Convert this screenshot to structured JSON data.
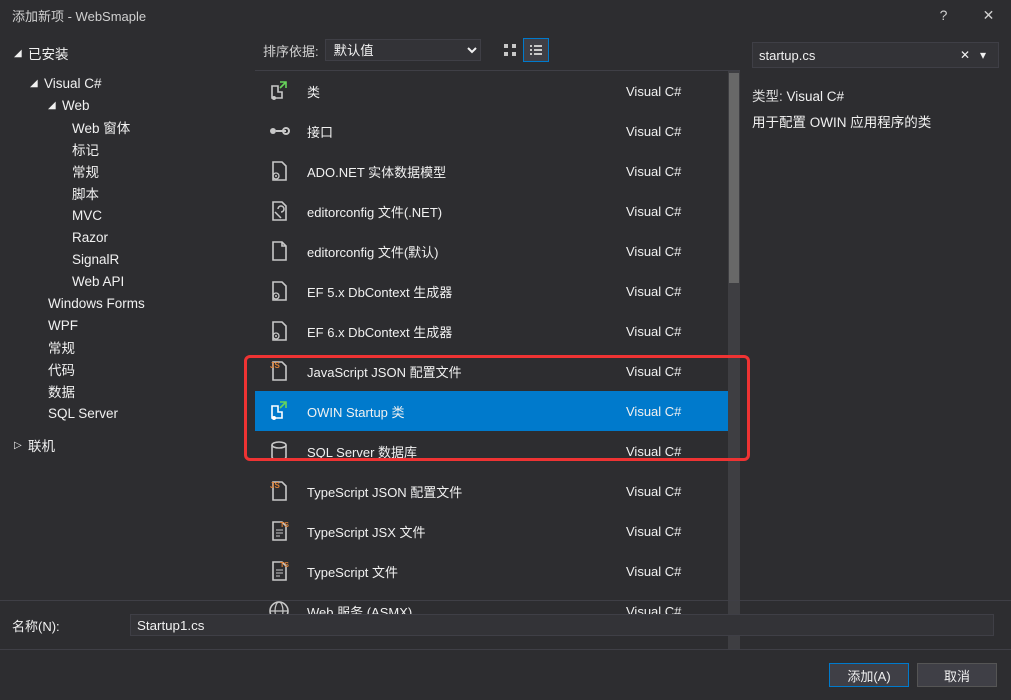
{
  "title": "添加新项 - WebSmaple",
  "tree": {
    "installed": "已安装",
    "csharp": "Visual C#",
    "web": "Web",
    "web_children": [
      "Web 窗体",
      "标记",
      "常规",
      "脚本",
      "MVC",
      "Razor",
      "SignalR",
      "Web API"
    ],
    "winforms": "Windows Forms",
    "wpf": "WPF",
    "general": "常规",
    "code": "代码",
    "data": "数据",
    "sql": "SQL Server",
    "online": "联机"
  },
  "sort": {
    "label": "排序依据:",
    "value": "默认值"
  },
  "items": [
    {
      "name": "类",
      "lang": "Visual C#",
      "icon": "class"
    },
    {
      "name": "接口",
      "lang": "Visual C#",
      "icon": "interface"
    },
    {
      "name": "ADO.NET 实体数据模型",
      "lang": "Visual C#",
      "icon": "file-gear"
    },
    {
      "name": "editorconfig 文件(.NET)",
      "lang": "Visual C#",
      "icon": "wrench"
    },
    {
      "name": "editorconfig 文件(默认)",
      "lang": "Visual C#",
      "icon": "file"
    },
    {
      "name": "EF 5.x DbContext 生成器",
      "lang": "Visual C#",
      "icon": "file-gear"
    },
    {
      "name": "EF 6.x DbContext 生成器",
      "lang": "Visual C#",
      "icon": "file-gear"
    },
    {
      "name": "JavaScript JSON 配置文件",
      "lang": "Visual C#",
      "icon": "file-js"
    },
    {
      "name": "OWIN Startup 类",
      "lang": "Visual C#",
      "icon": "class",
      "selected": true
    },
    {
      "name": "SQL Server 数据库",
      "lang": "Visual C#",
      "icon": "database"
    },
    {
      "name": "TypeScript JSON 配置文件",
      "lang": "Visual C#",
      "icon": "file-js"
    },
    {
      "name": "TypeScript JSX 文件",
      "lang": "Visual C#",
      "icon": "file-ts"
    },
    {
      "name": "TypeScript 文件",
      "lang": "Visual C#",
      "icon": "file-ts"
    },
    {
      "name": "Web 服务 (ASMX)",
      "lang": "Visual C#",
      "icon": "globe"
    }
  ],
  "search": {
    "value": "startup.cs"
  },
  "details": {
    "type_label": "类型:",
    "type_value": "Visual C#",
    "desc": "用于配置 OWIN 应用程序的类"
  },
  "name_field": {
    "label": "名称(N):",
    "value": "Startup1.cs"
  },
  "buttons": {
    "add": "添加(A)",
    "cancel": "取消"
  }
}
